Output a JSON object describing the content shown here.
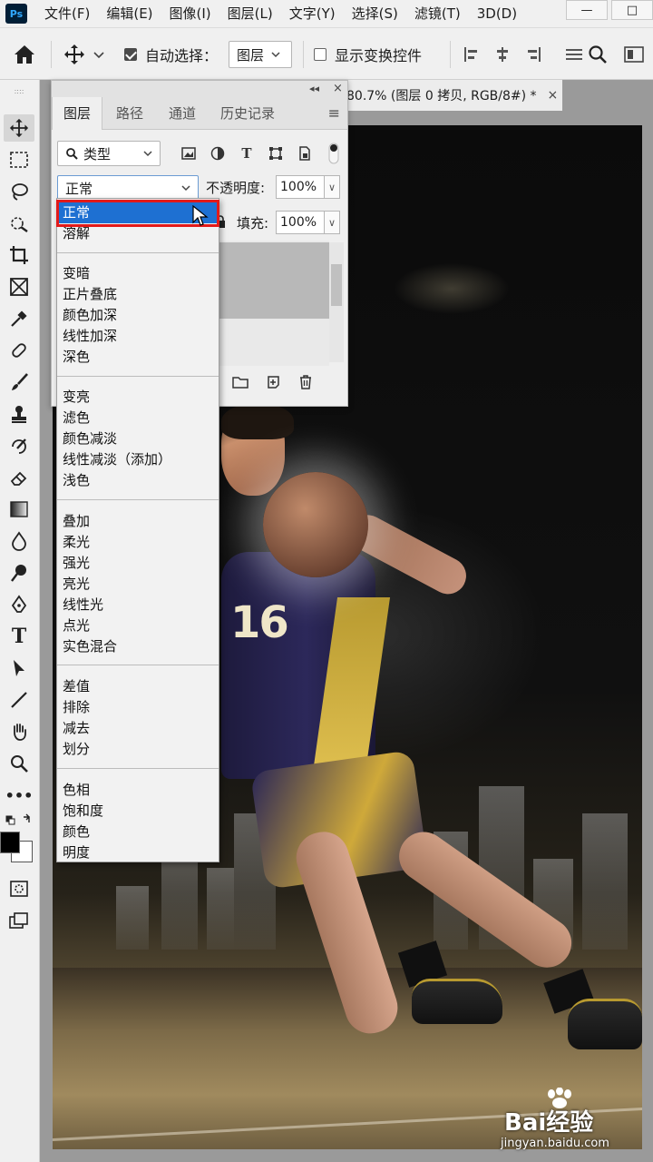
{
  "app": {
    "logo": "Ps"
  },
  "menubar": {
    "items": [
      "文件(F)",
      "编辑(E)",
      "图像(I)",
      "图层(L)",
      "文字(Y)",
      "选择(S)",
      "滤镜(T)",
      "3D(D)"
    ],
    "window_controls": [
      "minimize-icon",
      "restore-icon"
    ]
  },
  "optionsbar": {
    "auto_select_label": "自动选择：",
    "auto_select_checked": true,
    "auto_select_target": "图层",
    "show_transform_label": "显示变换控件",
    "show_transform_checked": false
  },
  "document": {
    "tab_title": "80.7% (图层 0 拷贝, RGB/8#) *",
    "close_glyph": "×",
    "jersey_number": "16"
  },
  "layers_panel": {
    "tabs": [
      "图层",
      "路径",
      "通道",
      "历史记录"
    ],
    "active_tab": "图层",
    "filter_label": "类型",
    "blend_mode": "正常",
    "opacity_label": "不透明度:",
    "opacity_value": "100%",
    "fill_label": "填充:",
    "fill_value": "100%"
  },
  "blend_dropdown": {
    "selected": "正常",
    "groups": [
      [
        "正常",
        "溶解"
      ],
      [
        "变暗",
        "正片叠底",
        "颜色加深",
        "线性加深",
        "深色"
      ],
      [
        "变亮",
        "滤色",
        "颜色减淡",
        "线性减淡（添加）",
        "浅色"
      ],
      [
        "叠加",
        "柔光",
        "强光",
        "亮光",
        "线性光",
        "点光",
        "实色混合"
      ],
      [
        "差值",
        "排除",
        "减去",
        "划分"
      ],
      [
        "色相",
        "饱和度",
        "颜色",
        "明度"
      ]
    ],
    "highlight_color": "#e21a1a",
    "selection_color": "#1e70d2"
  },
  "watermark": {
    "brand": "Bai经验",
    "url": "jingyan.baidu.com"
  }
}
